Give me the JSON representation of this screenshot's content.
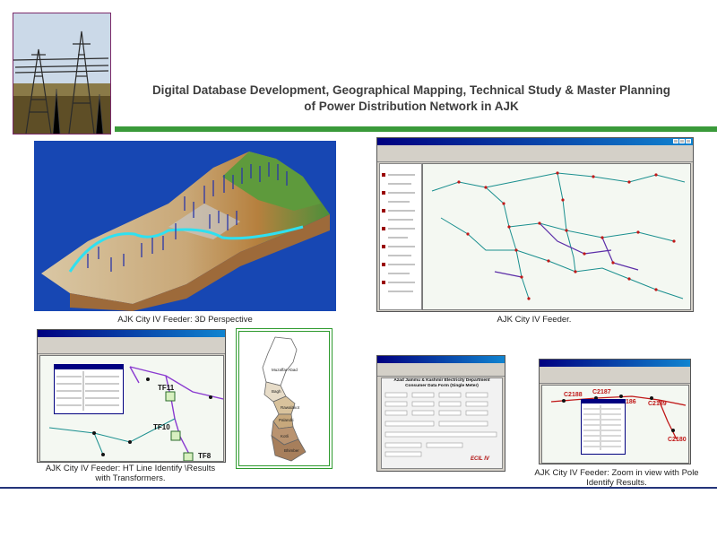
{
  "header": {
    "title_line1": "Digital Database Development, Geographical Mapping, Technical Study &  Master Planning",
    "title_line2": "of Power Distribution Network in AJK"
  },
  "colors": {
    "accent_green": "#3a9a3a",
    "rule_blue": "#24357a",
    "photo_border": "#7b2a6a",
    "map_frame_green": "#2e9a2e"
  },
  "panels": {
    "perspective": {
      "caption": "AJK City IV Feeder: 3D Perspective"
    },
    "feeder": {
      "caption": "AJK City IV Feeder."
    },
    "ht_line": {
      "caption_line1": "AJK City IV Feeder:  HT Line  Identify  \\Results",
      "caption_line2": "with Transformers.",
      "labels": [
        "TF11",
        "TF10",
        "TF8"
      ]
    },
    "district_map": {
      "regions": [
        "Muzaffar Abad",
        "Bagh",
        "Rawalakot",
        "Palandri",
        "Kotli",
        "Bhimber"
      ]
    },
    "consumer_form": {
      "line1": "Azad Jammu & Kashmir Electricity Department",
      "line2": "Consumer Data Form (Single Meter)",
      "logo": "ECIL IV"
    },
    "zoom": {
      "caption_line1": "AJK City IV Feeder:  Zoom  in  view with Pole",
      "caption_line2": "Identify  Results.",
      "labels": [
        "C2188",
        "C2187",
        "C2186",
        "C2189",
        "C2180"
      ]
    }
  }
}
